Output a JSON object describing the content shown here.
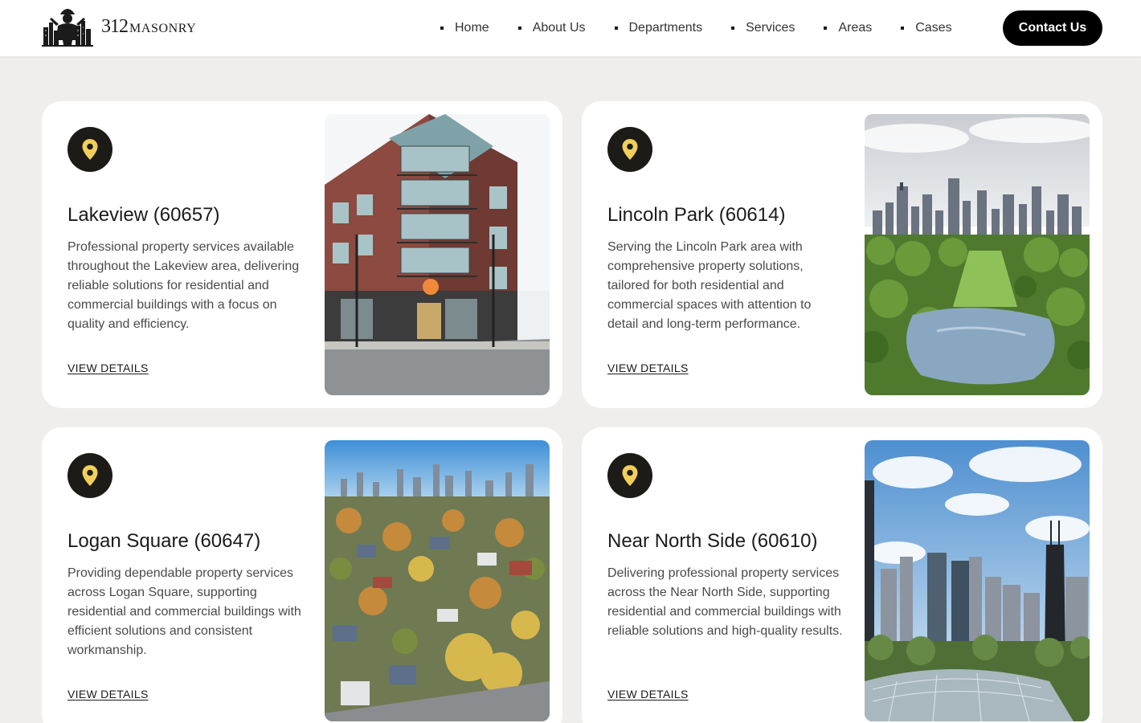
{
  "header": {
    "logo": {
      "number": "312",
      "word": "MASONRY"
    },
    "nav": [
      "Home",
      "About Us",
      "Departments",
      "Services",
      "Areas",
      "Cases"
    ],
    "contact_label": "Contact Us"
  },
  "cards": [
    {
      "title": "Lakeview (60657)",
      "description": "Professional property services available throughout the Lakeview area, delivering reliable solutions for residential and commercial buildings with a focus on quality and efficiency.",
      "link": "VIEW DETAILS",
      "image": "corner-brick-building-photo"
    },
    {
      "title": "Lincoln Park (60614)",
      "description": "Serving the Lincoln Park area with comprehensive property solutions, tailored for both residential and commercial spaces with attention to detail and long-term performance.",
      "link": "VIEW DETAILS",
      "image": "park-and-skyline-aerial-photo"
    },
    {
      "title": "Logan Square (60647)",
      "description": "Providing dependable property services across Logan Square, supporting residential and commercial buildings with efficient solutions and consistent workmanship.",
      "link": "VIEW DETAILS",
      "image": "neighborhood-aerial-photo"
    },
    {
      "title": "Near North Side (60610)",
      "description": "Delivering professional property services across the Near North Side, supporting residential and commercial buildings with reliable solutions and high-quality results.",
      "link": "VIEW DETAILS",
      "image": "downtown-towers-photo"
    }
  ],
  "colors": {
    "page_bg": "#efeeec",
    "card_bg": "#ffffff",
    "pin_bg": "#1d1b18",
    "pin_accent": "#f2cf5b",
    "button_bg": "#000000",
    "text": "#1b1b1b"
  },
  "icons": {
    "pin": "map-pin-icon",
    "nav_bullet": "square-bullet-icon"
  }
}
